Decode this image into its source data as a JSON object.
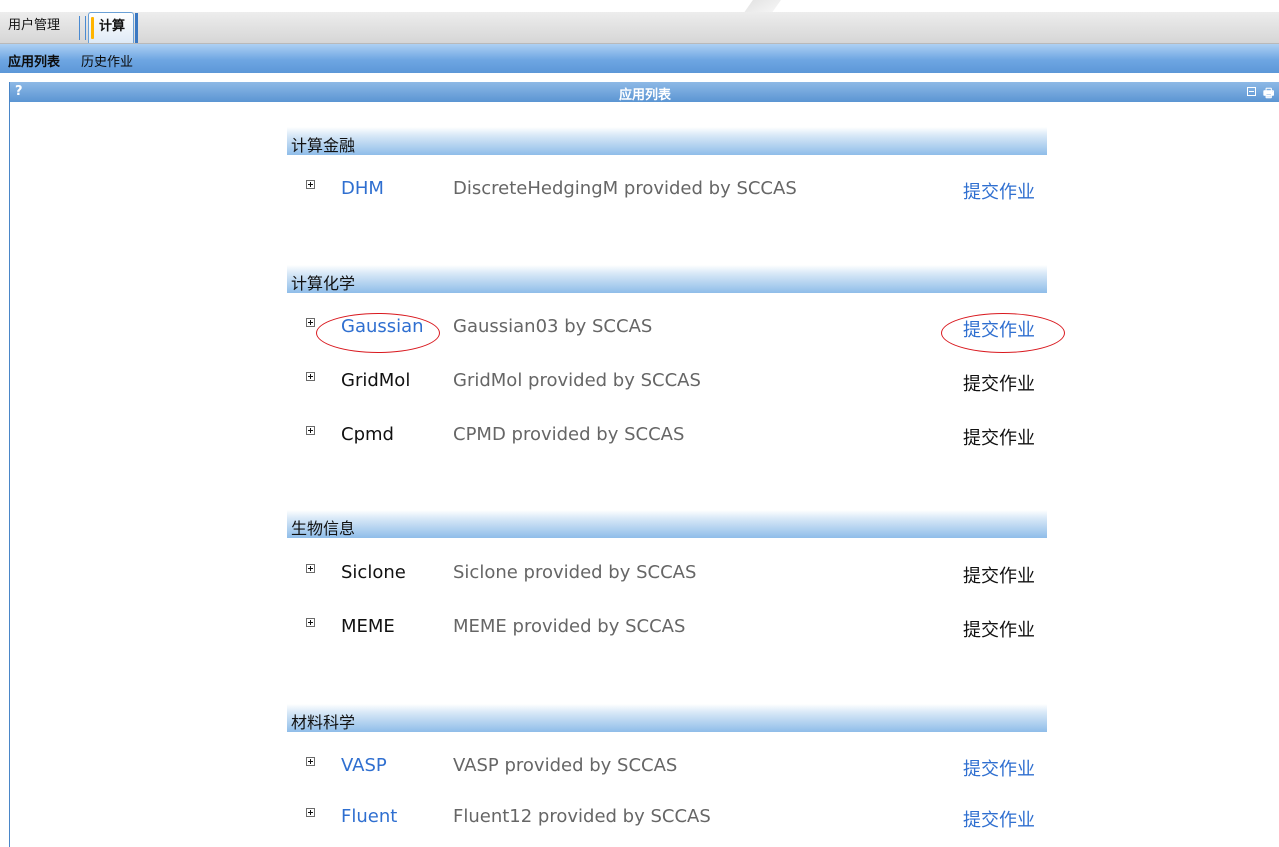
{
  "tabs": {
    "users_label": "用户管理",
    "compute_label": "计算"
  },
  "subnav": {
    "app_list_label": "应用列表",
    "history_label": "历史作业"
  },
  "panel": {
    "help_label": "?",
    "title": "应用列表",
    "print_glyph": "🖶"
  },
  "categories": [
    {
      "name": "计算金融",
      "apps": [
        {
          "name": "DHM",
          "desc": "DiscreteHedgingM provided by SCCAS",
          "submit": "提交作业",
          "linked": true
        }
      ]
    },
    {
      "name": "计算化学",
      "apps": [
        {
          "name": "Gaussian",
          "desc": "Gaussian03 by SCCAS",
          "submit": "提交作业",
          "linked": true
        },
        {
          "name": "GridMol",
          "desc": "GridMol provided by SCCAS",
          "submit": "提交作业",
          "linked": false
        },
        {
          "name": "Cpmd",
          "desc": "CPMD provided by SCCAS",
          "submit": "提交作业",
          "linked": false
        }
      ]
    },
    {
      "name": "生物信息",
      "apps": [
        {
          "name": "Siclone",
          "desc": "Siclone provided by SCCAS",
          "submit": "提交作业",
          "linked": false
        },
        {
          "name": "MEME",
          "desc": "MEME provided by SCCAS",
          "submit": "提交作业",
          "linked": false
        }
      ]
    },
    {
      "name": "材料科学",
      "apps": [
        {
          "name": "VASP",
          "desc": "VASP provided by SCCAS",
          "submit": "提交作业",
          "linked": true
        },
        {
          "name": "Fluent",
          "desc": "Fluent12 provided by SCCAS",
          "submit": "提交作业",
          "linked": true
        }
      ]
    }
  ],
  "colors": {
    "link": "#2f6fd0",
    "annotation": "#d9191f"
  }
}
